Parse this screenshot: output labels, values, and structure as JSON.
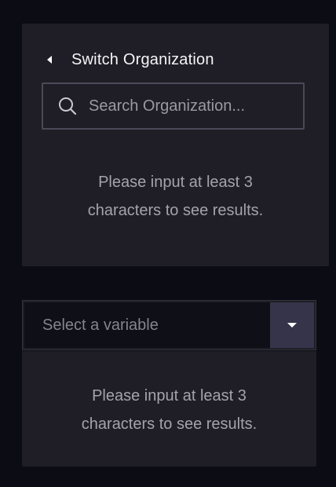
{
  "org_switcher": {
    "title": "Switch Organization",
    "back_icon": "caret-left-icon",
    "search": {
      "icon": "search-icon",
      "placeholder": "Search Organization...",
      "value": ""
    },
    "hint_line1": "Please input at least 3",
    "hint_line2": "characters to see results."
  },
  "variable_select": {
    "placeholder": "Select a variable",
    "toggle_icon": "caret-down-icon",
    "dropdown": {
      "hint_line1": "Please input at least 3",
      "hint_line2": "characters to see results."
    }
  },
  "colors": {
    "background": "#0c0c14",
    "panel": "#1f1e26",
    "input_border": "#4a4957",
    "select_field": "#0f0f17",
    "select_toggle": "#35344a",
    "text_primary": "#f5f5f7",
    "text_muted": "#a4a3ad"
  }
}
